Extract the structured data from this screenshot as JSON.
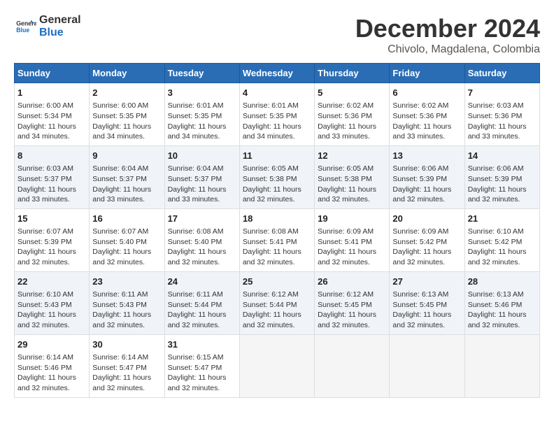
{
  "logo": {
    "line1": "General",
    "line2": "Blue"
  },
  "title": "December 2024",
  "subtitle": "Chivolo, Magdalena, Colombia",
  "days_of_week": [
    "Sunday",
    "Monday",
    "Tuesday",
    "Wednesday",
    "Thursday",
    "Friday",
    "Saturday"
  ],
  "weeks": [
    [
      {
        "day": 1,
        "lines": [
          "Sunrise: 6:00 AM",
          "Sunset: 5:34 PM",
          "Daylight: 11 hours",
          "and 34 minutes."
        ]
      },
      {
        "day": 2,
        "lines": [
          "Sunrise: 6:00 AM",
          "Sunset: 5:35 PM",
          "Daylight: 11 hours",
          "and 34 minutes."
        ]
      },
      {
        "day": 3,
        "lines": [
          "Sunrise: 6:01 AM",
          "Sunset: 5:35 PM",
          "Daylight: 11 hours",
          "and 34 minutes."
        ]
      },
      {
        "day": 4,
        "lines": [
          "Sunrise: 6:01 AM",
          "Sunset: 5:35 PM",
          "Daylight: 11 hours",
          "and 34 minutes."
        ]
      },
      {
        "day": 5,
        "lines": [
          "Sunrise: 6:02 AM",
          "Sunset: 5:36 PM",
          "Daylight: 11 hours",
          "and 33 minutes."
        ]
      },
      {
        "day": 6,
        "lines": [
          "Sunrise: 6:02 AM",
          "Sunset: 5:36 PM",
          "Daylight: 11 hours",
          "and 33 minutes."
        ]
      },
      {
        "day": 7,
        "lines": [
          "Sunrise: 6:03 AM",
          "Sunset: 5:36 PM",
          "Daylight: 11 hours",
          "and 33 minutes."
        ]
      }
    ],
    [
      {
        "day": 8,
        "lines": [
          "Sunrise: 6:03 AM",
          "Sunset: 5:37 PM",
          "Daylight: 11 hours",
          "and 33 minutes."
        ]
      },
      {
        "day": 9,
        "lines": [
          "Sunrise: 6:04 AM",
          "Sunset: 5:37 PM",
          "Daylight: 11 hours",
          "and 33 minutes."
        ]
      },
      {
        "day": 10,
        "lines": [
          "Sunrise: 6:04 AM",
          "Sunset: 5:37 PM",
          "Daylight: 11 hours",
          "and 33 minutes."
        ]
      },
      {
        "day": 11,
        "lines": [
          "Sunrise: 6:05 AM",
          "Sunset: 5:38 PM",
          "Daylight: 11 hours",
          "and 32 minutes."
        ]
      },
      {
        "day": 12,
        "lines": [
          "Sunrise: 6:05 AM",
          "Sunset: 5:38 PM",
          "Daylight: 11 hours",
          "and 32 minutes."
        ]
      },
      {
        "day": 13,
        "lines": [
          "Sunrise: 6:06 AM",
          "Sunset: 5:39 PM",
          "Daylight: 11 hours",
          "and 32 minutes."
        ]
      },
      {
        "day": 14,
        "lines": [
          "Sunrise: 6:06 AM",
          "Sunset: 5:39 PM",
          "Daylight: 11 hours",
          "and 32 minutes."
        ]
      }
    ],
    [
      {
        "day": 15,
        "lines": [
          "Sunrise: 6:07 AM",
          "Sunset: 5:39 PM",
          "Daylight: 11 hours",
          "and 32 minutes."
        ]
      },
      {
        "day": 16,
        "lines": [
          "Sunrise: 6:07 AM",
          "Sunset: 5:40 PM",
          "Daylight: 11 hours",
          "and 32 minutes."
        ]
      },
      {
        "day": 17,
        "lines": [
          "Sunrise: 6:08 AM",
          "Sunset: 5:40 PM",
          "Daylight: 11 hours",
          "and 32 minutes."
        ]
      },
      {
        "day": 18,
        "lines": [
          "Sunrise: 6:08 AM",
          "Sunset: 5:41 PM",
          "Daylight: 11 hours",
          "and 32 minutes."
        ]
      },
      {
        "day": 19,
        "lines": [
          "Sunrise: 6:09 AM",
          "Sunset: 5:41 PM",
          "Daylight: 11 hours",
          "and 32 minutes."
        ]
      },
      {
        "day": 20,
        "lines": [
          "Sunrise: 6:09 AM",
          "Sunset: 5:42 PM",
          "Daylight: 11 hours",
          "and 32 minutes."
        ]
      },
      {
        "day": 21,
        "lines": [
          "Sunrise: 6:10 AM",
          "Sunset: 5:42 PM",
          "Daylight: 11 hours",
          "and 32 minutes."
        ]
      }
    ],
    [
      {
        "day": 22,
        "lines": [
          "Sunrise: 6:10 AM",
          "Sunset: 5:43 PM",
          "Daylight: 11 hours",
          "and 32 minutes."
        ]
      },
      {
        "day": 23,
        "lines": [
          "Sunrise: 6:11 AM",
          "Sunset: 5:43 PM",
          "Daylight: 11 hours",
          "and 32 minutes."
        ]
      },
      {
        "day": 24,
        "lines": [
          "Sunrise: 6:11 AM",
          "Sunset: 5:44 PM",
          "Daylight: 11 hours",
          "and 32 minutes."
        ]
      },
      {
        "day": 25,
        "lines": [
          "Sunrise: 6:12 AM",
          "Sunset: 5:44 PM",
          "Daylight: 11 hours",
          "and 32 minutes."
        ]
      },
      {
        "day": 26,
        "lines": [
          "Sunrise: 6:12 AM",
          "Sunset: 5:45 PM",
          "Daylight: 11 hours",
          "and 32 minutes."
        ]
      },
      {
        "day": 27,
        "lines": [
          "Sunrise: 6:13 AM",
          "Sunset: 5:45 PM",
          "Daylight: 11 hours",
          "and 32 minutes."
        ]
      },
      {
        "day": 28,
        "lines": [
          "Sunrise: 6:13 AM",
          "Sunset: 5:46 PM",
          "Daylight: 11 hours",
          "and 32 minutes."
        ]
      }
    ],
    [
      {
        "day": 29,
        "lines": [
          "Sunrise: 6:14 AM",
          "Sunset: 5:46 PM",
          "Daylight: 11 hours",
          "and 32 minutes."
        ]
      },
      {
        "day": 30,
        "lines": [
          "Sunrise: 6:14 AM",
          "Sunset: 5:47 PM",
          "Daylight: 11 hours",
          "and 32 minutes."
        ]
      },
      {
        "day": 31,
        "lines": [
          "Sunrise: 6:15 AM",
          "Sunset: 5:47 PM",
          "Daylight: 11 hours",
          "and 32 minutes."
        ]
      },
      null,
      null,
      null,
      null
    ]
  ]
}
